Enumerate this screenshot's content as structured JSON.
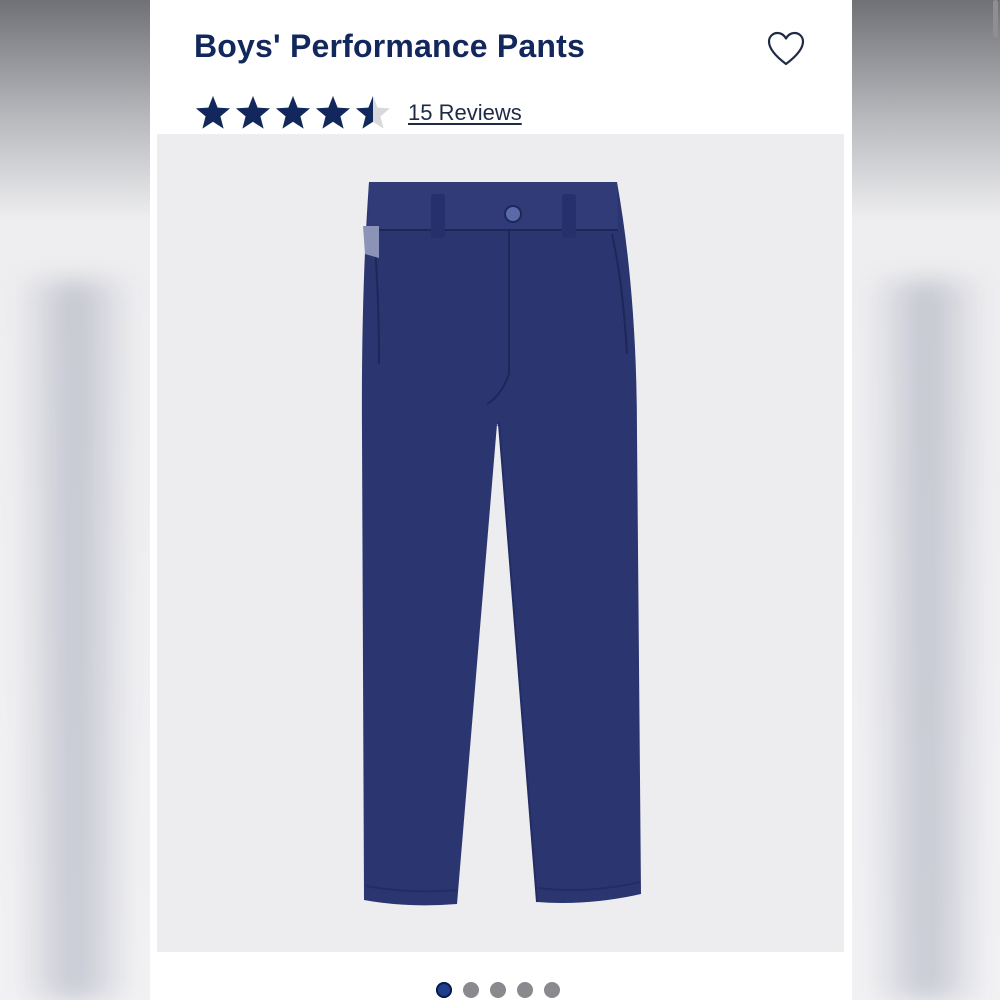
{
  "product": {
    "title": "Boys' Performance Pants",
    "rating": 4.5,
    "rating_max": 5,
    "reviews_label": "15 Reviews"
  },
  "favorite": {
    "icon": "heart-outline-icon"
  },
  "gallery": {
    "image_subject": "navy pants",
    "dot_count": 5,
    "active_index": 0
  },
  "colors": {
    "brand_navy": "#12275b",
    "star_fill": "#12275b",
    "star_empty": "#d9d9dc",
    "image_bg": "#ededef",
    "pants": "#2b3570"
  }
}
